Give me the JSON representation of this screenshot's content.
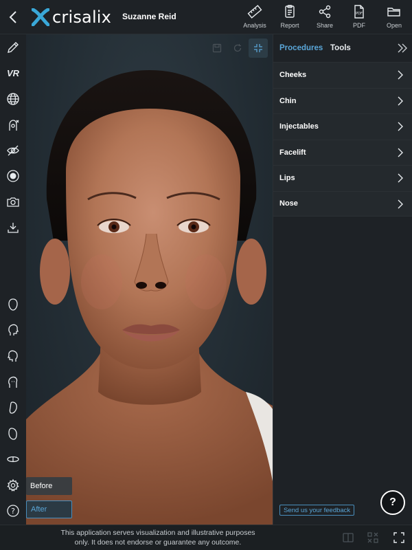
{
  "app": {
    "brand": "crisalix",
    "patient_name": "Suzanne Reid"
  },
  "toolbar": {
    "items": [
      {
        "label": "Analysis",
        "icon": "ruler-icon"
      },
      {
        "label": "Report",
        "icon": "clipboard-icon"
      },
      {
        "label": "Share",
        "icon": "share-icon"
      },
      {
        "label": "PDF",
        "icon": "pdf-file-icon"
      },
      {
        "label": "Open",
        "icon": "folder-icon"
      }
    ]
  },
  "left_tools": {
    "vr_label": "VR",
    "icons": [
      "pencil-icon",
      "vr-icon",
      "globe-icon",
      "head-tag-icon",
      "eye-off-icon",
      "record-icon",
      "camera-icon",
      "download-icon",
      "head-front-icon",
      "head-side-icon",
      "head-profile-icon",
      "head-pose-icon",
      "face-outline-icon",
      "face-contour-icon",
      "head-rotate-icon",
      "settings-icon",
      "help-icon"
    ]
  },
  "viewer": {
    "before_label": "Before",
    "after_label": "After",
    "selected_view": "After"
  },
  "panel": {
    "tabs": [
      {
        "label": "Procedures",
        "active": true
      },
      {
        "label": "Tools",
        "active": false
      }
    ],
    "procedures": [
      {
        "label": "Cheeks"
      },
      {
        "label": "Chin"
      },
      {
        "label": "Injectables"
      },
      {
        "label": "Facelift"
      },
      {
        "label": "Lips"
      },
      {
        "label": "Nose"
      }
    ],
    "feedback_label": "Send us your feedback",
    "help_label": "?"
  },
  "footer": {
    "disclaimer_line1": "This application serves visualization and illustrative purposes",
    "disclaimer_line2": "only. It does not endorse or guarantee any outcome."
  },
  "colors": {
    "accent": "#5aa6d8",
    "background": "#1b1f22",
    "panel": "#1e2226",
    "logo": "#3aa8d8"
  }
}
